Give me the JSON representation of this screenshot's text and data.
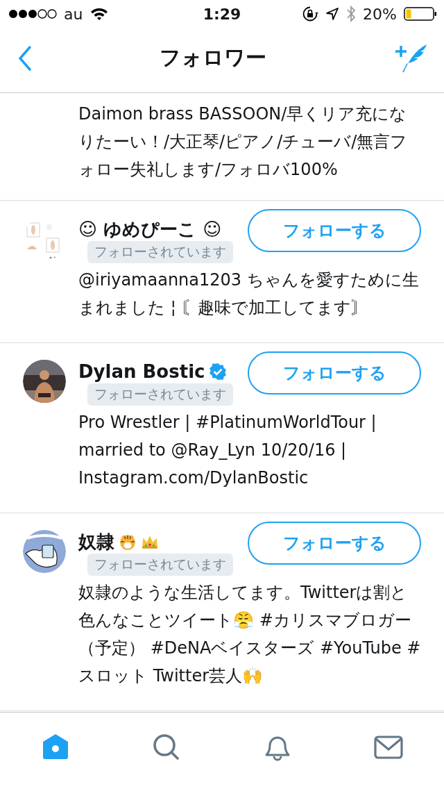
{
  "status_bar": {
    "carrier": "au",
    "time": "1:29",
    "battery": "20%"
  },
  "nav": {
    "title": "フォロワー"
  },
  "partial_row": {
    "bio": "Daimon brass BASSOON/早くリア充になりたーい！/大正琴/ピアノ/チューバ/無言フォロー失礼します/フォロバ100%"
  },
  "users": [
    {
      "avatar": {
        "kind": "picture"
      },
      "name": [
        {
          "kind": "text",
          "text": "☺ ゆめぴーこ ☺"
        }
      ],
      "verified": false,
      "follows_you": "フォローされています",
      "button": "フォローする",
      "bio": [
        {
          "kind": "text",
          "text": "@iriyamaanna1203 ちゃんを愛すために生まれました ¦ 〘趣味で加工してます〙"
        }
      ]
    },
    {
      "avatar": {
        "kind": "picture"
      },
      "name": [
        {
          "kind": "text",
          "text": "Dylan Bostic"
        }
      ],
      "verified": true,
      "follows_you": "フォローされています",
      "button": "フォローする",
      "bio": [
        {
          "kind": "text",
          "text": "Pro Wrestler | #PlatinumWorldTour | married to @Ray_Lyn 10/20/16 | Instagram.com/DylanBostic"
        }
      ]
    },
    {
      "avatar": {
        "kind": "picture"
      },
      "name": [
        {
          "kind": "text",
          "text": "奴隷"
        },
        {
          "kind": "tiger"
        },
        {
          "kind": "crown"
        }
      ],
      "verified": false,
      "follows_you": "フォローされています",
      "button": "フォローする",
      "bio": [
        {
          "kind": "text",
          "text": "奴隷のような生活してます。Twitterは割と色んなことツイート😤 #カリスマブロガー（予定） #DeNAベイスターズ #YouTube #スロット Twitter芸人🙌"
        }
      ]
    }
  ],
  "tabs": [
    {
      "kind": "home",
      "selected": true
    },
    {
      "kind": "search",
      "selected": false
    },
    {
      "kind": "bell",
      "selected": false
    },
    {
      "kind": "mail",
      "selected": false
    }
  ]
}
